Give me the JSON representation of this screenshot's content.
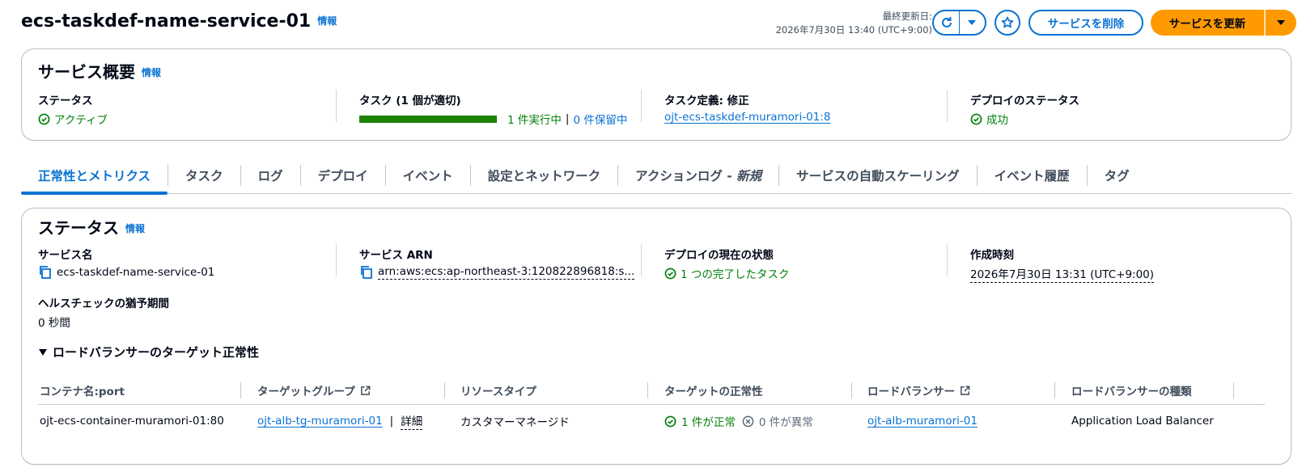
{
  "header": {
    "title": "ecs-taskdef-name-service-01",
    "info": "情報",
    "last_updated_label": "最終更新日:",
    "last_updated_value": "2026年7月30日 13:40 (UTC+9:00)",
    "delete_label": "サービスを削除",
    "update_label": "サービスを更新"
  },
  "overview": {
    "title": "サービス概要",
    "info": "情報",
    "status_label": "ステータス",
    "status_value": "アクティブ",
    "tasks_label": "タスク (1 個が適切)",
    "tasks_running": "1 件実行中",
    "tasks_sep": "|",
    "tasks_pending": "0 件保留中",
    "tasks_progress": 1.0,
    "taskdef_label": "タスク定義: 修正",
    "taskdef_value": "ojt-ecs-taskdef-muramori-01:8",
    "deploy_label": "デプロイのステータス",
    "deploy_value": "成功"
  },
  "tabs": [
    {
      "label": "正常性とメトリクス",
      "active": true
    },
    {
      "label": "タスク"
    },
    {
      "label": "ログ"
    },
    {
      "label": "デプロイ"
    },
    {
      "label": "イベント"
    },
    {
      "label": "設定とネットワーク"
    },
    {
      "label": "アクションログ - ",
      "italic": "新規"
    },
    {
      "label": "サービスの自動スケーリング"
    },
    {
      "label": "イベント履歴"
    },
    {
      "label": "タグ"
    }
  ],
  "status": {
    "title": "ステータス",
    "info": "情報",
    "service_name_label": "サービス名",
    "service_name_value": "ecs-taskdef-name-service-01",
    "arn_label": "サービス ARN",
    "arn_value": "arn:aws:ecs:ap-northeast-3:120822896818:s...",
    "deploy_state_label": "デプロイの現在の状態",
    "deploy_state_value": "1 つの完了したタスク",
    "created_label": "作成時刻",
    "created_value": "2026年7月30日 13:31 (UTC+9:00)",
    "grace_label": "ヘルスチェックの猶予期間",
    "grace_value": "0 秒間",
    "lb_section_title": "ロードバランサーのターゲット正常性"
  },
  "lb_table": {
    "headers": [
      "コンテナ名:port",
      "ターゲットグループ",
      "リソースタイプ",
      "ターゲットの正常性",
      "ロードバランサー",
      "ロードバランサーの種類"
    ],
    "row": {
      "container": "ojt-ecs-container-muramori-01:80",
      "target_group": "ojt-alb-tg-muramori-01",
      "tg_sep": "|",
      "detail": "詳細",
      "resource_type": "カスタマーマネージド",
      "healthy": "1 件が正常",
      "unhealthy": "0 件が異常",
      "load_balancer": "ojt-alb-muramori-01",
      "lb_type": "Application Load Balancer"
    }
  },
  "colors": {
    "link": "#0972d3",
    "success": "#037f0c",
    "primary_button": "#ff9900",
    "progress_fill": "#1d8102"
  }
}
